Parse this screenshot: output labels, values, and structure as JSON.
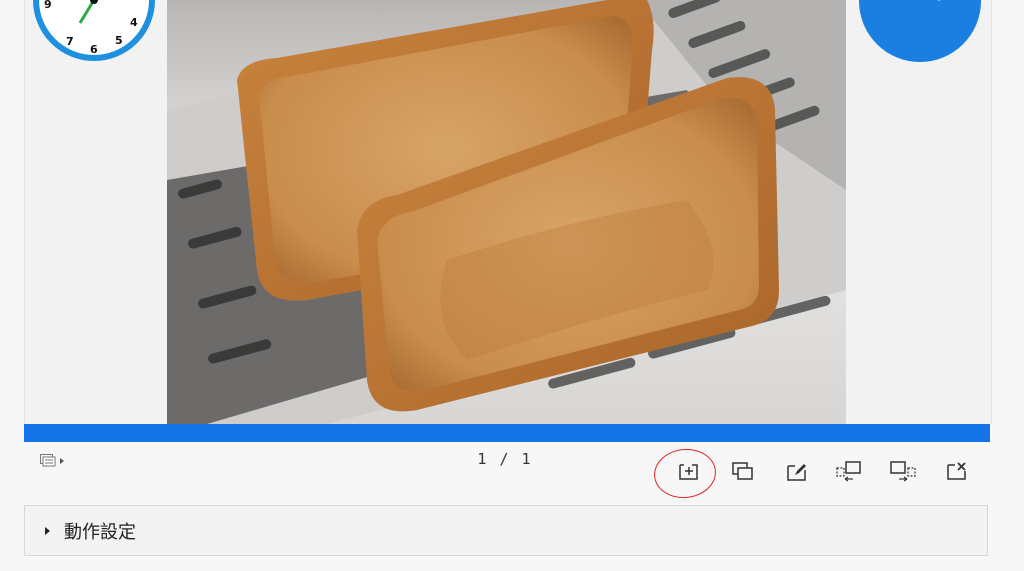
{
  "slide": {
    "image_alt": "Two slices of toast in a toaster",
    "progress_percent": 100
  },
  "pagination": {
    "current": "1",
    "separator": "/",
    "total": "1"
  },
  "toolbar": {
    "buttons": [
      "add-slide",
      "duplicate-slide",
      "edit-slide",
      "move-slide-before",
      "move-slide-after",
      "delete-slide"
    ]
  },
  "accordion": {
    "label": "動作設定"
  },
  "colors": {
    "accent": "#1473e6",
    "annotation": "#e0262b"
  }
}
